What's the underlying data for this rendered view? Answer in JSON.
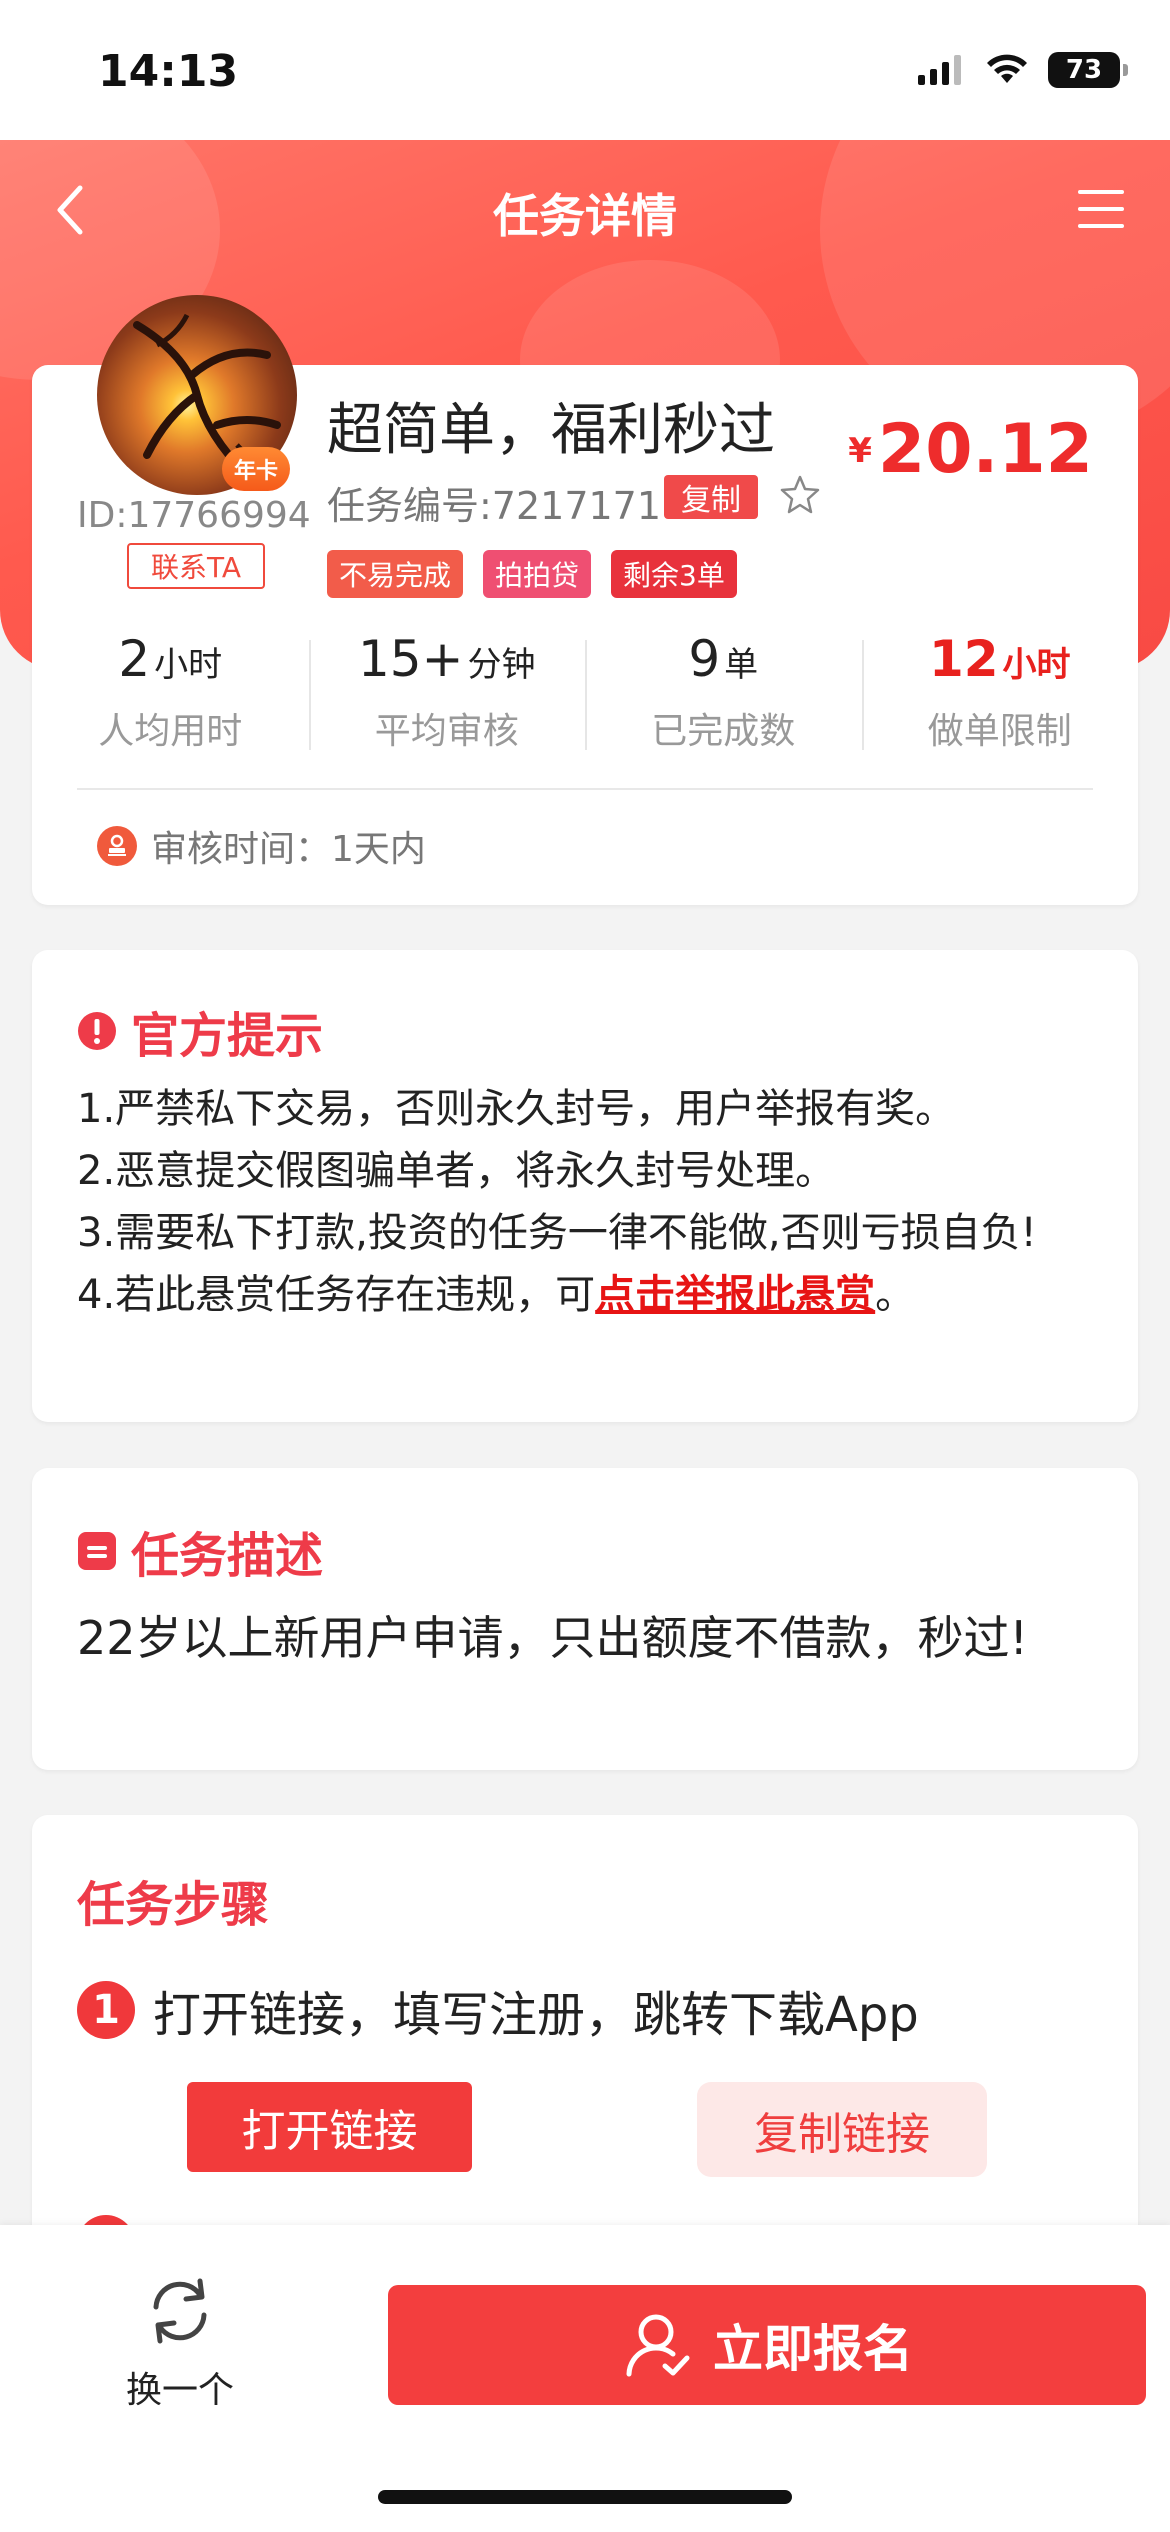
{
  "status_bar": {
    "time": "14:13",
    "battery": "73"
  },
  "nav": {
    "title": "任务详情"
  },
  "task": {
    "title": "超简单，福利秒过",
    "task_no": "任务编号:7217171",
    "copy_label": "复制",
    "price_symbol": "¥",
    "price": "20.12",
    "avatar_badge": "年卡",
    "user_id": "ID:17766994",
    "contact_label": "联系TA",
    "tags": [
      "不易完成",
      "拍拍贷",
      "剩余3单"
    ],
    "stats": [
      {
        "value": "2",
        "unit": "小时",
        "label": "人均用时"
      },
      {
        "value": "15+",
        "unit": "分钟",
        "label": "平均审核"
      },
      {
        "value": "9",
        "unit": "单",
        "label": "已完成数"
      },
      {
        "value": "12",
        "unit": "小时",
        "label": "做单限制"
      }
    ],
    "review_time": "审核时间：1天内"
  },
  "notice": {
    "title": "官方提示",
    "line1": "1.严禁私下交易，否则永久封号，用户举报有奖。",
    "line2": "2.恶意提交假图骗单者，将永久封号处理。",
    "line3": "3.需要私下打款,投资的任务一律不能做,否则亏损自负!",
    "line4_prefix": "4.若此悬赏任务存在违规，可",
    "line4_link": "点击举报此悬赏",
    "line4_suffix": "。"
  },
  "description": {
    "title": "任务描述",
    "text": "22岁以上新用户申请，只出额度不借款，秒过!"
  },
  "steps": {
    "title": "任务步骤",
    "step1_num": "1",
    "step1_text": "打开链接，填写注册，跳转下载App",
    "open_link_label": "打开链接",
    "copy_link_label": "复制链接"
  },
  "bottom": {
    "refresh_label": "换一个",
    "signup_label": "立即报名"
  },
  "colors": {
    "accent": "#f33e3e",
    "header_gradient_start": "#ff7568",
    "header_gradient_end": "#f84a44"
  }
}
